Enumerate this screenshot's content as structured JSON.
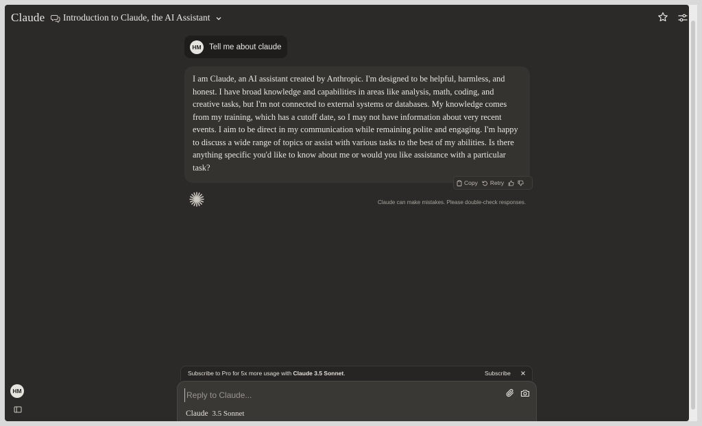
{
  "app": {
    "logo": "Claude"
  },
  "header": {
    "conversation_title": "Introduction to Claude, the AI Assistant"
  },
  "user": {
    "initials": "HM"
  },
  "messages": {
    "user_text": "Tell me about claude",
    "assistant_text": "I am Claude, an AI assistant created by Anthropic. I'm designed to be helpful, harmless, and honest. I have broad knowledge and capabilities in areas like analysis, math, coding, and creative tasks, but I'm not connected to external systems or databases. My knowledge comes from my training, which has a cutoff date, so I may not have information about very recent events. I aim to be direct in my communication while remaining polite and engaging. I'm happy to discuss a wide range of topics or assist with various tasks to the best of my abilities. Is there anything specific you'd like to know about me or would you like assistance with a particular task?"
  },
  "actions": {
    "copy": "Copy",
    "retry": "Retry"
  },
  "disclaimer": "Claude can make mistakes. Please double-check responses.",
  "subscribe": {
    "text_prefix": "Subscribe to Pro for 5x more usage with ",
    "text_bold": "Claude 3.5 Sonnet",
    "text_suffix": ".",
    "button": "Subscribe"
  },
  "composer": {
    "placeholder": "Reply to Claude...",
    "model_brand": "Claude",
    "model_name": "3.5 Sonnet"
  },
  "colors": {
    "background": "#2b2a28",
    "assistant_bubble": "#34332f",
    "user_bubble": "#1e1d1b",
    "text": "#e8e6e1"
  }
}
